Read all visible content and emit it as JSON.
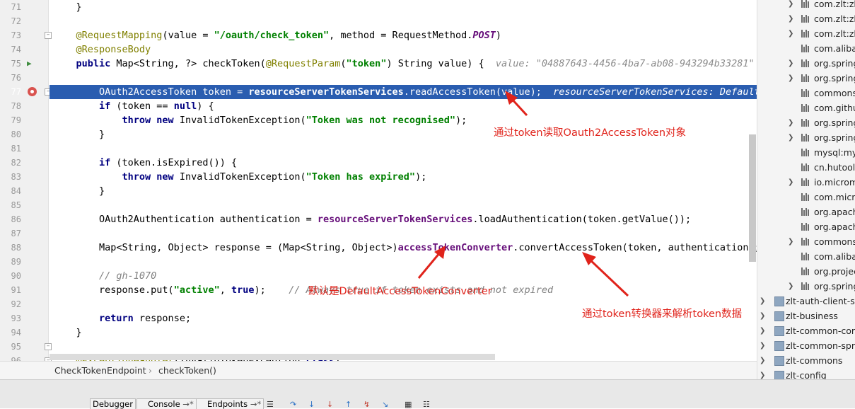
{
  "editor": {
    "lines": [
      {
        "n": "71",
        "segs": [
          [
            "",
            "    }"
          ]
        ]
      },
      {
        "n": "72",
        "segs": []
      },
      {
        "n": "73",
        "segs": [
          [
            "ann",
            "    @RequestMapping"
          ],
          [
            "",
            "(value = "
          ],
          [
            "str",
            "\"/oauth/check_token\""
          ],
          [
            "",
            ", method = RequestMethod."
          ],
          [
            "const",
            "POST"
          ],
          [
            "",
            ")"
          ]
        ]
      },
      {
        "n": "74",
        "segs": [
          [
            "ann",
            "    @ResponseBody"
          ]
        ]
      },
      {
        "n": "75",
        "segs": [
          [
            "kw",
            "    public "
          ],
          [
            "",
            "Map<String, ?> checkToken("
          ],
          [
            "ann",
            "@RequestParam"
          ],
          [
            "",
            "("
          ],
          [
            "str",
            "\"token\""
          ],
          [
            "",
            ") String value) {  "
          ],
          [
            "hint",
            "value: \"04887643-4456-4ba7-ab08-943294b33281\""
          ]
        ]
      },
      {
        "n": "76",
        "segs": []
      },
      {
        "n": "77",
        "segs": [
          [
            "",
            "        OAuth2AccessToken token = "
          ],
          [
            "fld",
            "resourceServerTokenServices"
          ],
          [
            "",
            ".readAccessToken(value);  "
          ],
          [
            "hint",
            "resourceServerTokenServices: DefaultTokenServices"
          ]
        ],
        "highlight": true
      },
      {
        "n": "78",
        "segs": [
          [
            "kw",
            "        if "
          ],
          [
            "",
            "(token == "
          ],
          [
            "kw",
            "null"
          ],
          [
            "",
            ") {"
          ]
        ]
      },
      {
        "n": "79",
        "segs": [
          [
            "kw",
            "            throw new "
          ],
          [
            "",
            "InvalidTokenException("
          ],
          [
            "str",
            "\"Token was not recognised\""
          ],
          [
            "",
            ");"
          ]
        ]
      },
      {
        "n": "80",
        "segs": [
          [
            "",
            "        }"
          ]
        ]
      },
      {
        "n": "81",
        "segs": []
      },
      {
        "n": "82",
        "segs": [
          [
            "kw",
            "        if "
          ],
          [
            "",
            "(token.isExpired()) {"
          ]
        ]
      },
      {
        "n": "83",
        "segs": [
          [
            "kw",
            "            throw new "
          ],
          [
            "",
            "InvalidTokenException("
          ],
          [
            "str",
            "\"Token has expired\""
          ],
          [
            "",
            ");"
          ]
        ]
      },
      {
        "n": "84",
        "segs": [
          [
            "",
            "        }"
          ]
        ]
      },
      {
        "n": "85",
        "segs": []
      },
      {
        "n": "86",
        "segs": [
          [
            "",
            "        OAuth2Authentication authentication = "
          ],
          [
            "fld",
            "resourceServerTokenServices"
          ],
          [
            "",
            ".loadAuthentication(token.getValue());"
          ]
        ]
      },
      {
        "n": "87",
        "segs": []
      },
      {
        "n": "88",
        "segs": [
          [
            "",
            "        Map<String, Object> response = (Map<String, Object>)"
          ],
          [
            "fld",
            "accessTokenConverter"
          ],
          [
            "",
            ".convertAccessToken(token, authentication);"
          ]
        ]
      },
      {
        "n": "89",
        "segs": []
      },
      {
        "n": "90",
        "segs": [
          [
            "cmt",
            "        // gh-1070"
          ]
        ]
      },
      {
        "n": "91",
        "segs": [
          [
            "",
            "        response.put("
          ],
          [
            "str",
            "\"active\""
          ],
          [
            "",
            ", "
          ],
          [
            "kw",
            "true"
          ],
          [
            "",
            ");    "
          ],
          [
            "cmt",
            "// Always true if token exists and not expired"
          ]
        ]
      },
      {
        "n": "92",
        "segs": []
      },
      {
        "n": "93",
        "segs": [
          [
            "kw",
            "        return "
          ],
          [
            "",
            "response;"
          ]
        ]
      },
      {
        "n": "94",
        "segs": [
          [
            "",
            "    }"
          ]
        ]
      },
      {
        "n": "95",
        "segs": []
      },
      {
        "n": "96",
        "segs": [
          [
            "ann",
            "    @ExceptionHandler"
          ],
          [
            "",
            "(InvalidTokenException."
          ],
          [
            "kw",
            "class"
          ],
          [
            "",
            ")"
          ]
        ]
      }
    ]
  },
  "annotations": {
    "note1": "通过token读取Oauth2AccessToken对象",
    "note2": "默认是DefaultAccessTokenConverter",
    "note3": "通过token转换器来解析token数据"
  },
  "breadcrumb": {
    "class_name": "CheckTokenEndpoint",
    "method_name": "checkToken()"
  },
  "bottom_tabs": {
    "debugger": "Debugger",
    "console": "Console",
    "endpoints": "Endpoints"
  },
  "tree": {
    "items": [
      {
        "label": "com.zlt:zlt-",
        "chev": true,
        "type": "lib"
      },
      {
        "label": "com.zlt:zlt-",
        "chev": true,
        "type": "lib"
      },
      {
        "label": "com.zlt:zlt-",
        "chev": true,
        "type": "lib"
      },
      {
        "label": "com.alibab",
        "chev": false,
        "type": "lib"
      },
      {
        "label": "org.spring",
        "chev": true,
        "type": "lib"
      },
      {
        "label": "org.spring",
        "chev": true,
        "type": "lib"
      },
      {
        "label": "commons-",
        "chev": false,
        "type": "lib"
      },
      {
        "label": "com.githul",
        "chev": false,
        "type": "lib"
      },
      {
        "label": "org.spring",
        "chev": true,
        "type": "lib"
      },
      {
        "label": "org.spring",
        "chev": true,
        "type": "lib"
      },
      {
        "label": "mysql:mys",
        "chev": false,
        "type": "lib"
      },
      {
        "label": "cn.hutool:",
        "chev": false,
        "type": "lib"
      },
      {
        "label": "io.microm",
        "chev": true,
        "type": "lib"
      },
      {
        "label": "com.micro",
        "chev": false,
        "type": "lib"
      },
      {
        "label": "org.apach",
        "chev": false,
        "type": "lib"
      },
      {
        "label": "org.apach",
        "chev": false,
        "type": "lib"
      },
      {
        "label": "commons-",
        "chev": true,
        "type": "lib"
      },
      {
        "label": "com.alibab",
        "chev": false,
        "type": "lib"
      },
      {
        "label": "org.projec",
        "chev": false,
        "type": "lib"
      },
      {
        "label": "org.spring",
        "chev": true,
        "type": "lib"
      },
      {
        "label": "zlt-auth-client-spr",
        "chev": true,
        "type": "mod"
      },
      {
        "label": "zlt-business",
        "chev": true,
        "type": "mod"
      },
      {
        "label": "zlt-common-core",
        "chev": true,
        "type": "mod"
      },
      {
        "label": "zlt-common-sprir",
        "chev": true,
        "type": "mod"
      },
      {
        "label": "zlt-commons",
        "chev": true,
        "type": "mod"
      },
      {
        "label": "zlt-config",
        "chev": true,
        "type": "mod"
      }
    ]
  }
}
